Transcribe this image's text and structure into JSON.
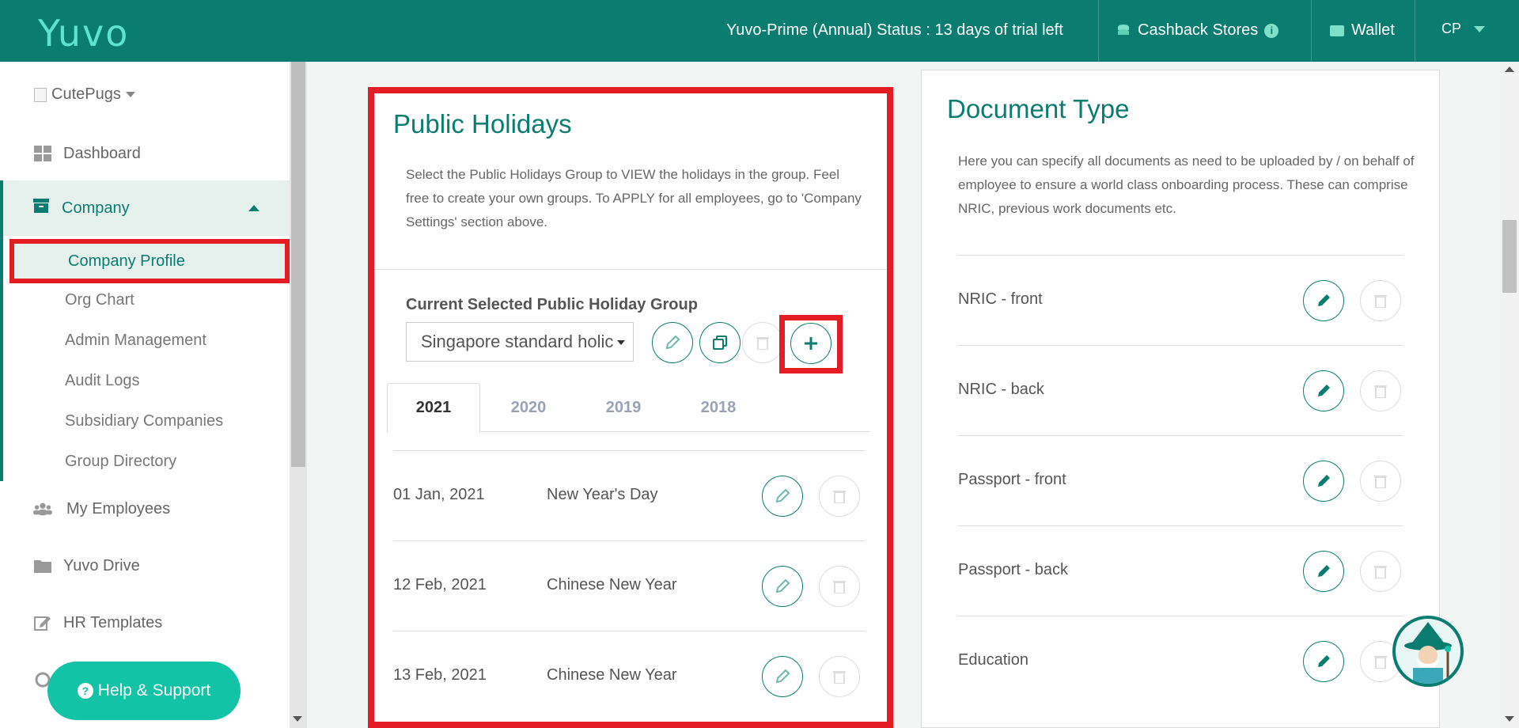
{
  "topbar": {
    "logo": "Yuvo",
    "status": "Yuvo-Prime (Annual) Status : 13 days of trial left",
    "cashback": "Cashback Stores",
    "wallet": "Wallet",
    "user": "CP"
  },
  "sidebar": {
    "company_name": "CutePugs",
    "dashboard": "Dashboard",
    "company": "Company",
    "company_items": [
      "Company Profile",
      "Org Chart",
      "Admin Management",
      "Audit Logs",
      "Subsidiary Companies",
      "Group Directory"
    ],
    "my_employees": "My Employees",
    "yuvo_drive": "Yuvo Drive",
    "hr_templates": "HR Templates",
    "help": "Help & Support"
  },
  "holidays": {
    "title": "Public Holidays",
    "description": "Select the Public Holidays Group to VIEW the holidays in the group. Feel free to create your own groups. To APPLY for all employees, go to 'Company Settings' section above.",
    "current_label": "Current Selected Public Holiday Group",
    "selected_group": "Singapore standard holic",
    "tabs": [
      "2021",
      "2020",
      "2019",
      "2018"
    ],
    "rows": [
      {
        "date": "01 Jan, 2021",
        "name": "New Year's Day"
      },
      {
        "date": "12 Feb, 2021",
        "name": "Chinese New Year"
      },
      {
        "date": "13 Feb, 2021",
        "name": "Chinese New Year"
      }
    ]
  },
  "doctype": {
    "title": "Document Type",
    "description": "Here you can specify all documents as need to be uploaded by / on behalf of employee to ensure a world class onboarding process. These can comprise NRIC, previous work documents etc.",
    "rows": [
      "NRIC - front",
      "NRIC - back",
      "Passport - front",
      "Passport - back",
      "Education"
    ]
  },
  "colors": {
    "brand": "#0b7c70",
    "highlight": "#e41c24",
    "help": "#12c3a5"
  }
}
